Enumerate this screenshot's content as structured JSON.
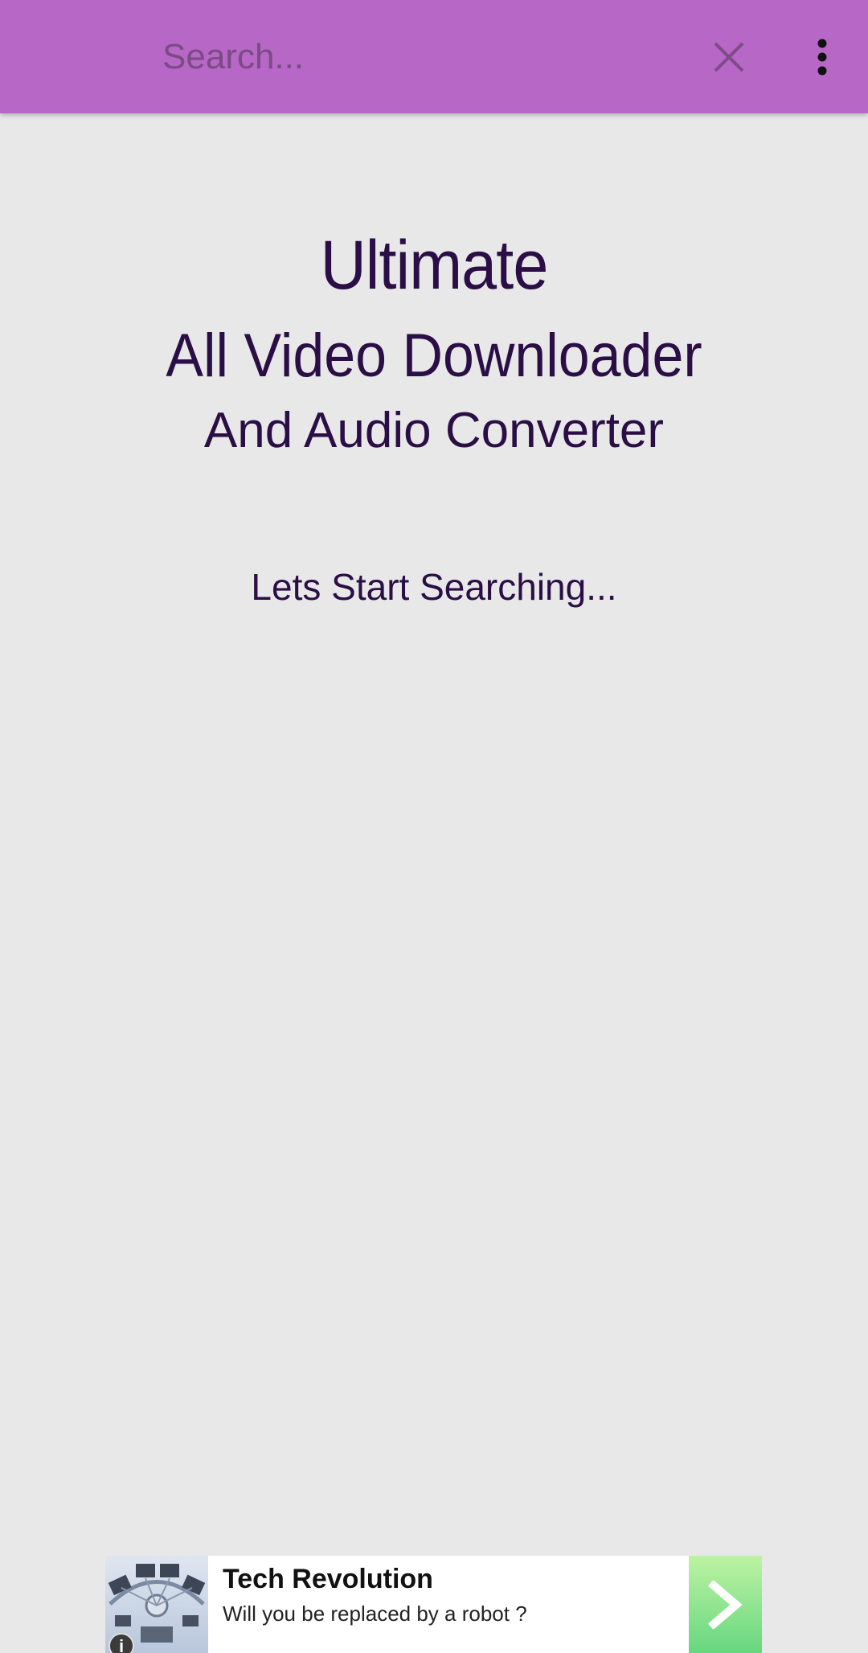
{
  "search": {
    "placeholder": "Search...",
    "value": "",
    "search_icon": "clear-icon",
    "menu_icon": "more-vert-icon"
  },
  "hero": {
    "line1": "Ultimate",
    "line2": "All Video Downloader",
    "line3": "And Audio Converter",
    "prompt": "Lets Start Searching..."
  },
  "ad": {
    "title": "Tech Revolution",
    "subtitle": "Will you be replaced by a robot ?",
    "info_icon": "info-icon",
    "cta_icon": "chevron-right-icon"
  },
  "colors": {
    "app_bar": "#b767c6",
    "background": "#e8e8e9",
    "hero_text": "#2a0e45",
    "ad_cta": "#8ae38b"
  }
}
